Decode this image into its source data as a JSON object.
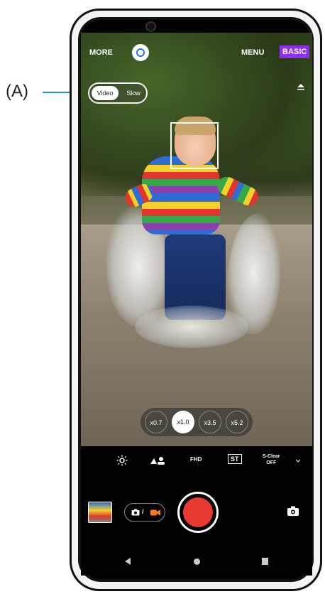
{
  "annotation": {
    "label": "(A)"
  },
  "top_bar": {
    "more_label": "MORE",
    "menu_label": "MENU",
    "basic_label": "BASIC",
    "lens_icon": "google-lens-icon"
  },
  "mode_toggle": {
    "video_label": "Video",
    "slow_label": "Slow",
    "selected": "Video"
  },
  "zoom": {
    "options": [
      "x0.7",
      "x1.0",
      "x3.5",
      "x5.2"
    ],
    "selected": "x1.0"
  },
  "settings": {
    "brightness_icon": "brightness-icon",
    "scene_icon": "scene-person-icon",
    "resolution_label": "FHD",
    "st_label": "ST",
    "sclear_label": "S-Clear",
    "sclear_value": "OFF",
    "expand_icon": "chevron-down-icon"
  },
  "bottom": {
    "switch_icon_text": "📷 /",
    "shutter_color": "#e63a33",
    "flip_icon": "camera-flip-icon"
  },
  "nav": {
    "back": "back-icon",
    "home": "home-icon",
    "recent": "recents-icon"
  },
  "colors": {
    "annotation": "#2a8fd6",
    "basic_bg": "#8e2ff0",
    "shutter": "#e63a33"
  }
}
